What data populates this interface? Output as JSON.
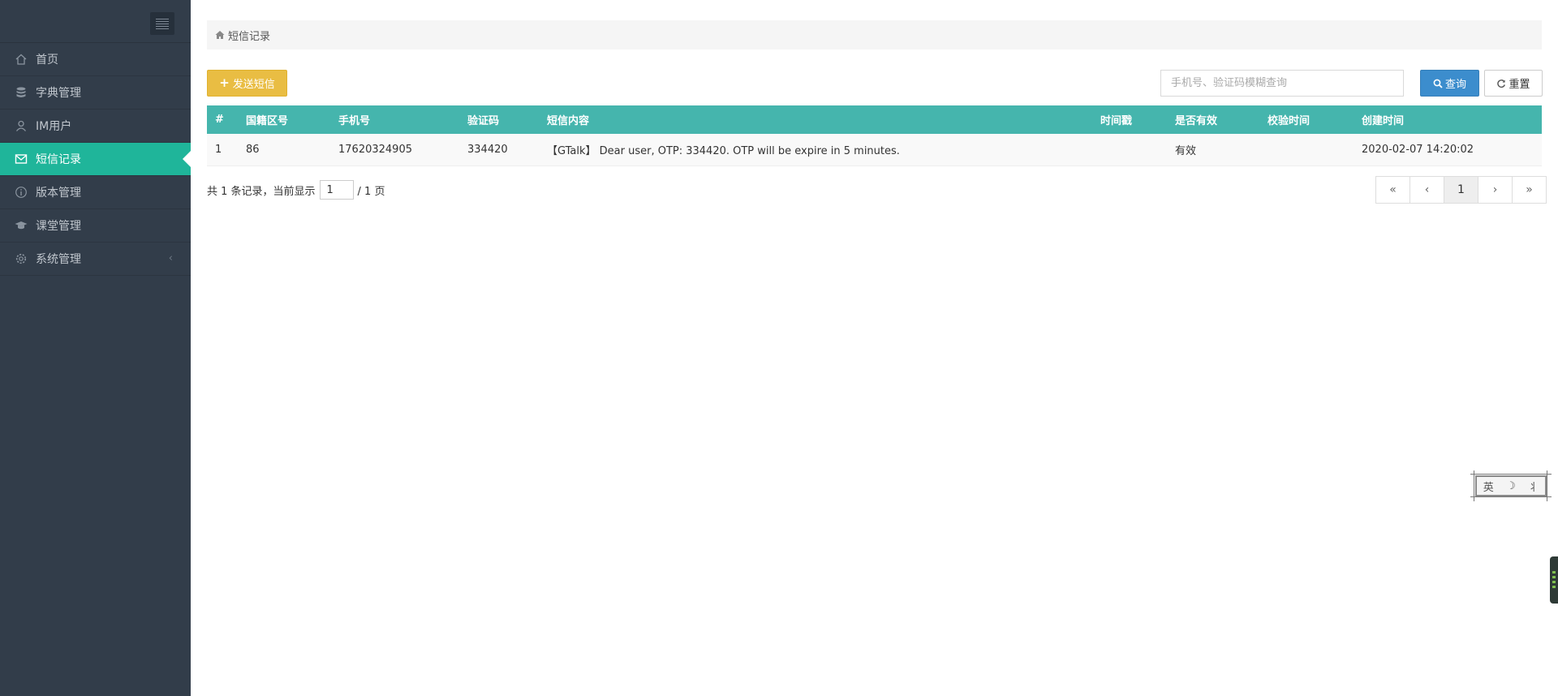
{
  "sidebar": {
    "items": [
      {
        "label": "首页",
        "icon": "home-icon"
      },
      {
        "label": "字典管理",
        "icon": "database-icon"
      },
      {
        "label": "IM用户",
        "icon": "user-icon"
      },
      {
        "label": "短信记录",
        "icon": "envelope-icon",
        "active": true
      },
      {
        "label": "版本管理",
        "icon": "info-icon"
      },
      {
        "label": "课堂管理",
        "icon": "graduation-cap-icon"
      },
      {
        "label": "系统管理",
        "icon": "gear-icon",
        "chevron": "‹"
      }
    ]
  },
  "breadcrumb": {
    "label": "短信记录",
    "icon": "home-icon"
  },
  "toolbar": {
    "send_label": "发送短信",
    "send_icon": "+",
    "search_placeholder": "手机号、验证码模糊查询",
    "query_label": "查询",
    "reset_label": "重置"
  },
  "table": {
    "headers": [
      "#",
      "国籍区号",
      "手机号",
      "验证码",
      "短信内容",
      "时间戳",
      "是否有效",
      "校验时间",
      "创建时间"
    ],
    "rows": [
      {
        "index": "1",
        "country_code": "86",
        "phone": "17620324905",
        "code": "334420",
        "content": "【GTalk】 Dear user, OTP: 334420. OTP will be expire in 5 minutes.",
        "timestamp": "",
        "valid": "有效",
        "verify_time": "",
        "created": "2020-02-07 14:20:02"
      }
    ]
  },
  "pager": {
    "prefix": "共 1 条记录，当前显示",
    "current_page": "1",
    "suffix": "/ 1 页",
    "buttons": [
      "«",
      "‹",
      "1",
      "›",
      "»"
    ]
  },
  "ime": {
    "chars": [
      "英",
      "☽",
      "⺦"
    ]
  },
  "colors": {
    "sidebar_bg": "#323d4a",
    "active": "#1fb59a",
    "table_header": "#45b5ad",
    "primary": "#3c8dcd",
    "warning": "#e9bd43",
    "valid_text": "#2e8b2e"
  }
}
